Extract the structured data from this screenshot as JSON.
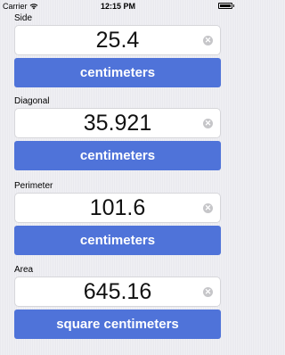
{
  "status_bar": {
    "carrier": "Carrier",
    "time": "12:15 PM"
  },
  "sections": [
    {
      "label": "Side",
      "value": "25.4",
      "unit": "centimeters"
    },
    {
      "label": "Diagonal",
      "value": "35.921",
      "unit": "centimeters"
    },
    {
      "label": "Perimeter",
      "value": "101.6",
      "unit": "centimeters"
    },
    {
      "label": "Area",
      "value": "645.16",
      "unit": "square centimeters"
    }
  ],
  "icons": {
    "clear": "clear-circle-icon",
    "wifi": "wifi-icon",
    "battery": "battery-icon"
  },
  "colors": {
    "button": "#4f73d9",
    "button_text": "#ffffff",
    "field_bg": "#ffffff",
    "clear_icon": "#c6c6c9"
  }
}
